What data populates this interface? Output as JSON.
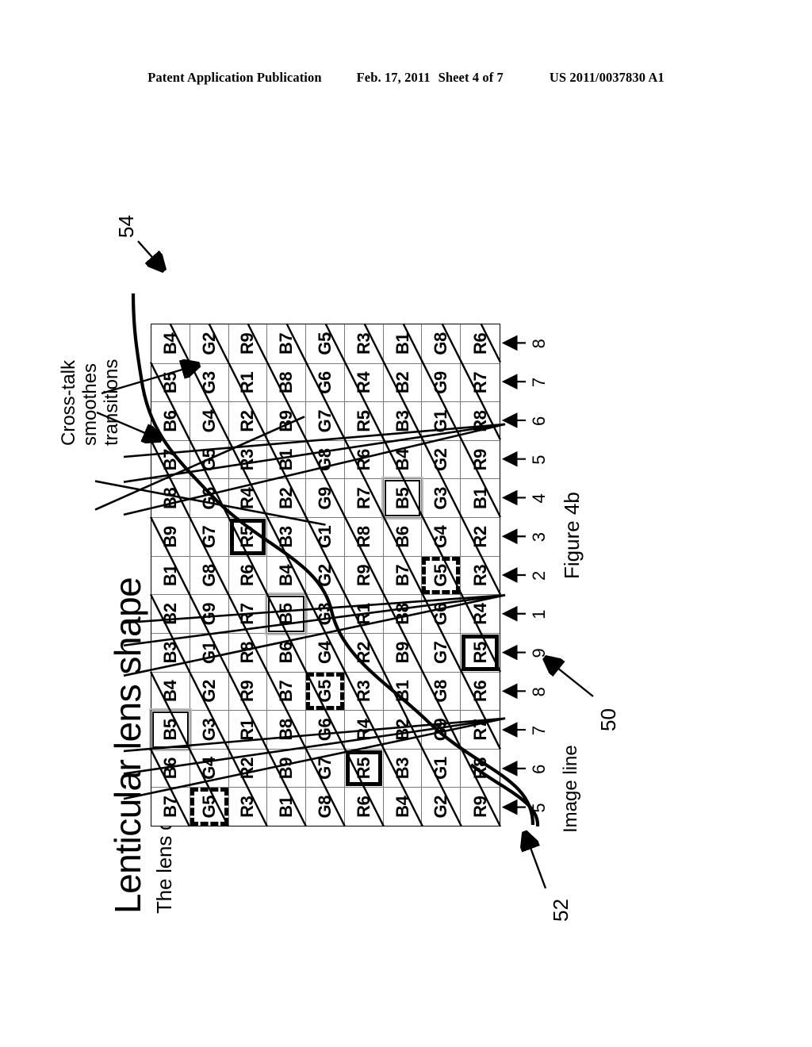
{
  "header": {
    "left": "Patent Application Publication",
    "date": "Feb. 17, 2011",
    "sheet": "Sheet 4 of 7",
    "pubnum": "US 2011/0037830 A1"
  },
  "figure": {
    "title": "Lenticular lens shape",
    "subtitle": "The lens directs each line of pixels to a different viewing angle.",
    "caption": "Figure 4b",
    "image_line_label": "Image line",
    "crosstalk_note_lines": [
      "Cross-talk",
      "smoothes",
      "transitions"
    ],
    "ref_numbers": [
      "50",
      "52",
      "54"
    ],
    "image_line_ticks": [
      "5",
      "6",
      "7",
      "8",
      "9",
      "1",
      "2",
      "3",
      "4",
      "5",
      "6",
      "7",
      "8"
    ],
    "colors": {
      "ink": "#000000",
      "grid_line": "#7a7a7a",
      "highlight_gray": "#bdbdbd",
      "background": "#ffffff"
    }
  },
  "chart_data": {
    "type": "table",
    "title": "Lenticular lens shape",
    "description": "Pixel sub-element map: 9 rows by 13 columns of R/G/B sub-pixels, each numbered 1-9 for the view it is directed to. Highlighted cells mark view 5 (bold), view 5 green (dashed) and view 5 blue (double-line) sub-pixels.",
    "rows": 9,
    "cols": 13,
    "cells": [
      [
        "B7",
        "B6",
        "B5",
        "B4",
        "B3",
        "B2",
        "B1",
        "B9",
        "B8",
        "B7",
        "B6",
        "B5",
        "B4"
      ],
      [
        "G5",
        "G4",
        "G3",
        "G2",
        "G1",
        "G9",
        "G8",
        "G7",
        "G6",
        "G5",
        "G4",
        "G3",
        "G2"
      ],
      [
        "R3",
        "R2",
        "R1",
        "R9",
        "R8",
        "R7",
        "R6",
        "R5",
        "R4",
        "R3",
        "R2",
        "R1",
        "R9"
      ],
      [
        "B1",
        "B9",
        "B8",
        "B7",
        "B6",
        "B5",
        "B4",
        "B3",
        "B2",
        "B1",
        "B9",
        "B8",
        "B7"
      ],
      [
        "G8",
        "G7",
        "G6",
        "G5",
        "G4",
        "G3",
        "G2",
        "G1",
        "G9",
        "G8",
        "G7",
        "G6",
        "G5"
      ],
      [
        "R6",
        "R5",
        "R4",
        "R3",
        "R2",
        "R1",
        "R9",
        "R8",
        "R7",
        "R6",
        "R5",
        "R4",
        "R3"
      ],
      [
        "B4",
        "B3",
        "B2",
        "B1",
        "B9",
        "B8",
        "B7",
        "B6",
        "B5",
        "B4",
        "B3",
        "B2",
        "B1"
      ],
      [
        "G2",
        "G1",
        "G9",
        "G8",
        "G7",
        "G6",
        "G5",
        "G4",
        "G3",
        "G2",
        "G1",
        "G9",
        "G8"
      ],
      [
        "R9",
        "R8",
        "R7",
        "R6",
        "R5",
        "R4",
        "R3",
        "R2",
        "B1",
        "R9",
        "R8",
        "R7",
        "R6"
      ]
    ],
    "highlights": [
      {
        "row": 0,
        "col": 2,
        "style": "double"
      },
      {
        "row": 1,
        "col": 0,
        "style": "dash"
      },
      {
        "row": 2,
        "col": 7,
        "style": "bold"
      },
      {
        "row": 3,
        "col": 5,
        "style": "double"
      },
      {
        "row": 4,
        "col": 3,
        "style": "dash"
      },
      {
        "row": 5,
        "col": 1,
        "style": "bold"
      },
      {
        "row": 6,
        "col": 8,
        "style": "double"
      },
      {
        "row": 7,
        "col": 6,
        "style": "dash"
      },
      {
        "row": 8,
        "col": 4,
        "style": "bold"
      }
    ],
    "xlabel": "Image line",
    "ylabel": "",
    "legend": []
  }
}
